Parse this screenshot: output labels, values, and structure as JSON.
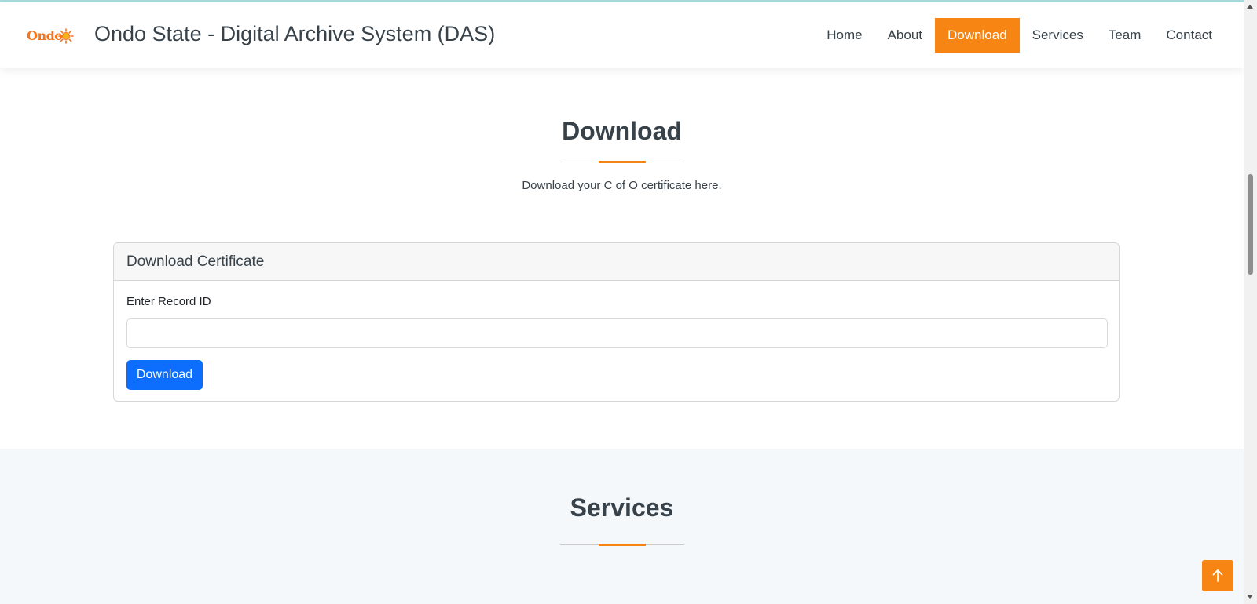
{
  "header": {
    "logo_text": "Ondo",
    "title": "Ondo State - Digital Archive System (DAS)",
    "nav": [
      {
        "label": "Home",
        "active": false
      },
      {
        "label": "About",
        "active": false
      },
      {
        "label": "Download",
        "active": true
      },
      {
        "label": "Services",
        "active": false
      },
      {
        "label": "Team",
        "active": false
      },
      {
        "label": "Contact",
        "active": false
      }
    ]
  },
  "download_section": {
    "title": "Download",
    "subtitle": "Download your C of O certificate here.",
    "card": {
      "header": "Download Certificate",
      "field_label": "Enter Record ID",
      "field_value": "",
      "button_label": "Download"
    }
  },
  "services_section": {
    "title": "Services"
  },
  "icons": {
    "back_to_top": "arrow-up-icon",
    "logo_mark": "sun-icon"
  },
  "colors": {
    "accent": "#f78513",
    "primary_button": "#0d6efd",
    "text": "#37424a",
    "services_background": "#f5f8fb"
  }
}
